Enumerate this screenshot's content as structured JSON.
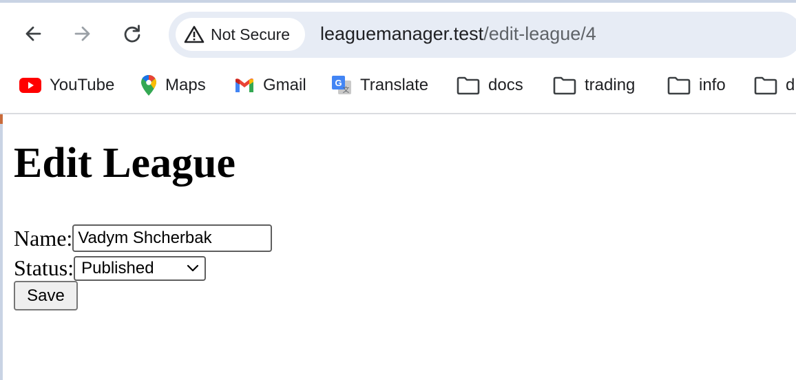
{
  "browser": {
    "security_chip": "Not Secure",
    "url_host": "leaguemanager.test",
    "url_path": "/edit-league/4",
    "bookmarks": [
      {
        "label": "YouTube",
        "icon": "youtube-icon"
      },
      {
        "label": "Maps",
        "icon": "maps-icon"
      },
      {
        "label": "Gmail",
        "icon": "gmail-icon"
      },
      {
        "label": "Translate",
        "icon": "translate-icon"
      },
      {
        "label": "docs",
        "icon": "folder-icon"
      },
      {
        "label": "trading",
        "icon": "folder-icon"
      },
      {
        "label": "info",
        "icon": "folder-icon"
      },
      {
        "label": "d",
        "icon": "folder-icon"
      }
    ]
  },
  "page": {
    "title": "Edit League",
    "name_label": "Name:",
    "name_value": "Vadym Shcherbak",
    "status_label": "Status:",
    "status_value": "Published",
    "save_label": "Save"
  },
  "colors": {
    "omnibox_bg": "#e7ecf5",
    "top_strip": "#c9d3e4",
    "text": "#202124"
  }
}
